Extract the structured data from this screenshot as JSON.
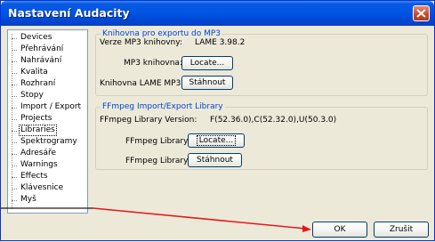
{
  "window": {
    "title": "Nastavení Audacity"
  },
  "sidebar": {
    "items": [
      {
        "label": "Devices"
      },
      {
        "label": "Přehrávání"
      },
      {
        "label": "Nahrávání"
      },
      {
        "label": "Kvalita"
      },
      {
        "label": "Rozhraní"
      },
      {
        "label": "Stopy"
      },
      {
        "label": "Import / Export"
      },
      {
        "label": "Projects"
      },
      {
        "label": "Libraries"
      },
      {
        "label": "Spektrogramy"
      },
      {
        "label": "Adresáře"
      },
      {
        "label": "Warnings"
      },
      {
        "label": "Effects"
      },
      {
        "label": "Klávesnice"
      },
      {
        "label": "Myš"
      }
    ],
    "selected": "Libraries"
  },
  "mp3_group": {
    "title": "Knihovna pro exportu do MP3",
    "version_label": "Verze MP3 knihovny:",
    "version_value": "LAME 3.98.2",
    "library_label": "MP3 knihovna:",
    "locate_label": "Locate...",
    "download_label_text": "Knihovna LAME MP3:",
    "download_button": "Stáhnout"
  },
  "ffmpeg_group": {
    "title": "FFmpeg Import/Export Library",
    "version_label": "FFmpeg Library Version:",
    "version_value": "F(52.36.0),C(52.32.0),U(50.3.0)",
    "library_label": "FFmpeg Library:",
    "locate_label": "Locate...",
    "download_label_text": "FFmpeg Library:",
    "download_button": "Stáhnout"
  },
  "footer": {
    "ok_label": "OK",
    "cancel_label": "Zrušit"
  },
  "colors": {
    "title_bar": "#0055e5",
    "group_title": "#0046d5",
    "annotation_arrow": "#e8141e"
  }
}
